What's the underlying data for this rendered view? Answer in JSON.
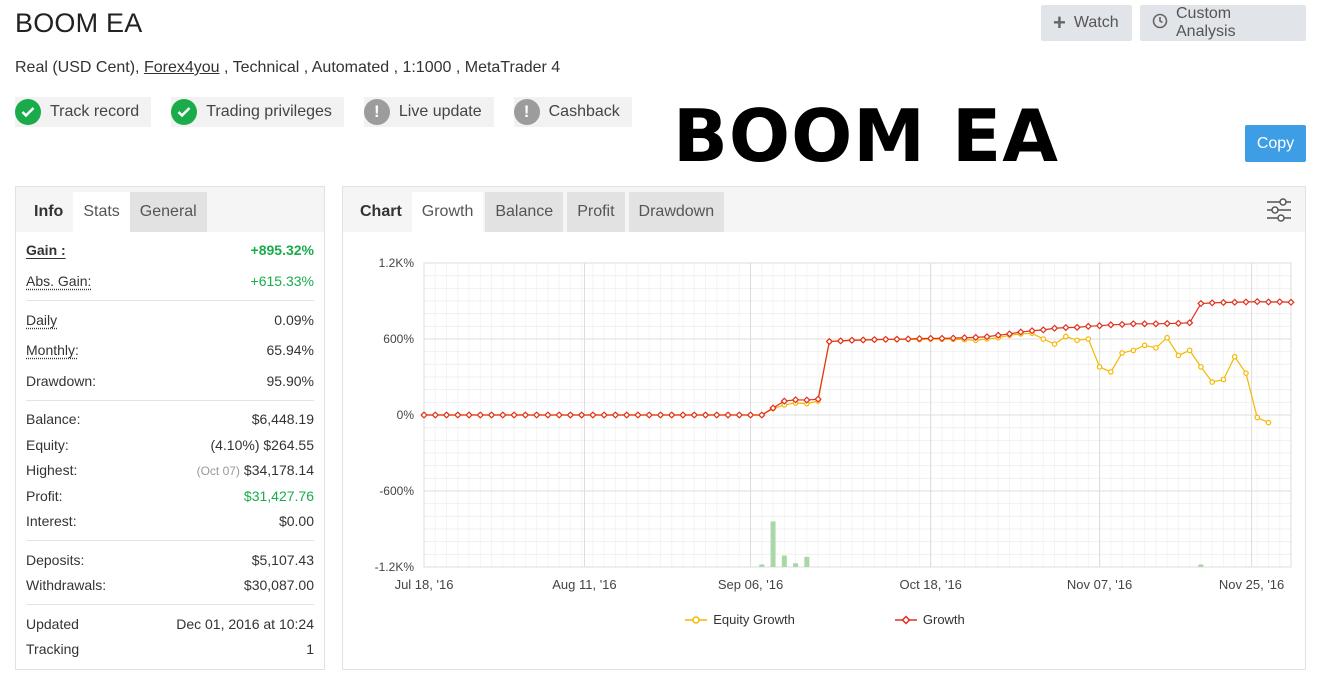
{
  "header": {
    "title": "BOOM EA",
    "subtitle_prefix": "Real (USD Cent),",
    "broker_link": "Forex4you",
    "subtitle_suffix": ", Technical , Automated , 1:1000 , MetaTrader 4",
    "watch_label": "Watch",
    "analysis_label": "Custom Analysis",
    "copy_label": "Copy",
    "overlay_text": "BOOM EA"
  },
  "badges": [
    {
      "label": "Track record",
      "status": "verified",
      "icon": "check-icon"
    },
    {
      "label": "Trading privileges",
      "status": "verified",
      "icon": "check-icon"
    },
    {
      "label": "Live update",
      "status": "unverified",
      "icon": "exclamation-icon"
    },
    {
      "label": "Cashback",
      "status": "unverified",
      "icon": "exclamation-icon"
    }
  ],
  "left_tabs": {
    "info": "Info",
    "stats": "Stats",
    "general": "General"
  },
  "stats": {
    "gain_label": "Gain :",
    "gain": "+895.32%",
    "abs_gain_label": "Abs. Gain:",
    "abs_gain": "+615.33%",
    "daily_label": "Daily",
    "daily": "0.09%",
    "monthly_label": "Monthly:",
    "monthly": "65.94%",
    "drawdown_label": "Drawdown:",
    "drawdown": "95.90%",
    "balance_label": "Balance:",
    "balance": "$6,448.19",
    "equity_label": "Equity:",
    "equity_pct": "(4.10%)",
    "equity": "$264.55",
    "highest_label": "Highest:",
    "highest_date": "(Oct 07)",
    "highest": "$34,178.14",
    "profit_label": "Profit:",
    "profit": "$31,427.76",
    "interest_label": "Interest:",
    "interest": "$0.00",
    "deposits_label": "Deposits:",
    "deposits": "$5,107.43",
    "withdrawals_label": "Withdrawals:",
    "withdrawals": "$30,087.00",
    "updated_label": "Updated",
    "updated": "Dec 01, 2016 at 10:24",
    "tracking_label": "Tracking",
    "tracking": "1"
  },
  "right_tabs": {
    "chart": "Chart",
    "growth": "Growth",
    "balance": "Balance",
    "profit": "Profit",
    "drawdown": "Drawdown"
  },
  "colors": {
    "green": "#1aab4b",
    "equity": "#f5b800",
    "growth": "#e0301e",
    "volume": "#a8d8a8",
    "copy": "#3d9ee6"
  },
  "chart_data": {
    "type": "line",
    "y_ticks": [
      "1.2K%",
      "600%",
      "0%",
      "-600%",
      "-1.2K%"
    ],
    "y_tick_values": [
      1200,
      600,
      0,
      -600,
      -1200
    ],
    "ylim": [
      -1200,
      1200
    ],
    "x_ticks": [
      "Jul 18, '16",
      "Aug 11, '16",
      "Sep 06, '16",
      "Oct 18, '16",
      "Nov 07, '16",
      "Nov 25, '16"
    ],
    "x_tick_index": [
      0,
      24,
      50,
      92,
      112,
      130
    ],
    "x_count": 135,
    "series": [
      {
        "name": "Growth",
        "points": [
          [
            0,
            0
          ],
          [
            2,
            0
          ],
          [
            4,
            0
          ],
          [
            6,
            0
          ],
          [
            8,
            0
          ],
          [
            10,
            0
          ],
          [
            12,
            0
          ],
          [
            14,
            0
          ],
          [
            16,
            0
          ],
          [
            18,
            0
          ],
          [
            20,
            0
          ],
          [
            22,
            0
          ],
          [
            24,
            0
          ],
          [
            26,
            0
          ],
          [
            28,
            0
          ],
          [
            30,
            0
          ],
          [
            32,
            0
          ],
          [
            34,
            0
          ],
          [
            36,
            0
          ],
          [
            38,
            0
          ],
          [
            40,
            0
          ],
          [
            42,
            0
          ],
          [
            44,
            0
          ],
          [
            46,
            0
          ],
          [
            48,
            0
          ],
          [
            50,
            0
          ],
          [
            52,
            0
          ],
          [
            54,
            0
          ],
          [
            56,
            0
          ],
          [
            58,
            0
          ],
          [
            60,
            0
          ],
          [
            62,
            55
          ],
          [
            64,
            110
          ],
          [
            66,
            120
          ],
          [
            68,
            118
          ],
          [
            70,
            125
          ],
          [
            72,
            580
          ],
          [
            74,
            585
          ],
          [
            76,
            590
          ],
          [
            78,
            592
          ],
          [
            80,
            595
          ],
          [
            82,
            597
          ],
          [
            84,
            598
          ],
          [
            86,
            600
          ],
          [
            88,
            603
          ],
          [
            90,
            605
          ],
          [
            92,
            605
          ],
          [
            94,
            607
          ],
          [
            96,
            610
          ],
          [
            98,
            613
          ],
          [
            100,
            618
          ],
          [
            102,
            630
          ],
          [
            104,
            640
          ],
          [
            106,
            655
          ],
          [
            108,
            665
          ],
          [
            110,
            672
          ],
          [
            112,
            685
          ],
          [
            114,
            690
          ],
          [
            116,
            692
          ],
          [
            118,
            700
          ],
          [
            120,
            705
          ],
          [
            122,
            712
          ],
          [
            124,
            715
          ],
          [
            126,
            720
          ],
          [
            128,
            720
          ],
          [
            130,
            720
          ],
          [
            132,
            722
          ],
          [
            134,
            724
          ],
          [
            136,
            728
          ],
          [
            138,
            880
          ],
          [
            140,
            885
          ],
          [
            142,
            888
          ],
          [
            144,
            890
          ],
          [
            146,
            892
          ],
          [
            148,
            895
          ],
          [
            150,
            892
          ],
          [
            152,
            893
          ],
          [
            154,
            890
          ]
        ]
      },
      {
        "name": "Equity Growth",
        "points": [
          [
            0,
            0
          ],
          [
            2,
            0
          ],
          [
            4,
            0
          ],
          [
            6,
            0
          ],
          [
            8,
            0
          ],
          [
            10,
            0
          ],
          [
            12,
            0
          ],
          [
            14,
            0
          ],
          [
            16,
            0
          ],
          [
            18,
            0
          ],
          [
            20,
            0
          ],
          [
            22,
            0
          ],
          [
            24,
            0
          ],
          [
            26,
            0
          ],
          [
            28,
            0
          ],
          [
            30,
            0
          ],
          [
            32,
            0
          ],
          [
            34,
            0
          ],
          [
            36,
            0
          ],
          [
            38,
            0
          ],
          [
            40,
            0
          ],
          [
            42,
            0
          ],
          [
            44,
            0
          ],
          [
            46,
            0
          ],
          [
            48,
            0
          ],
          [
            50,
            0
          ],
          [
            52,
            0
          ],
          [
            54,
            0
          ],
          [
            56,
            0
          ],
          [
            58,
            0
          ],
          [
            60,
            0
          ],
          [
            62,
            50
          ],
          [
            64,
            80
          ],
          [
            66,
            95
          ],
          [
            68,
            90
          ],
          [
            70,
            110
          ],
          [
            72,
            580
          ],
          [
            74,
            585
          ],
          [
            76,
            590
          ],
          [
            78,
            592
          ],
          [
            80,
            595
          ],
          [
            82,
            597
          ],
          [
            84,
            598
          ],
          [
            86,
            598
          ],
          [
            88,
            595
          ],
          [
            90,
            600
          ],
          [
            92,
            598
          ],
          [
            94,
            598
          ],
          [
            96,
            595
          ],
          [
            98,
            590
          ],
          [
            100,
            600
          ],
          [
            102,
            610
          ],
          [
            104,
            630
          ],
          [
            106,
            640
          ],
          [
            108,
            645
          ],
          [
            110,
            600
          ],
          [
            112,
            560
          ],
          [
            114,
            620
          ],
          [
            116,
            590
          ],
          [
            118,
            600
          ],
          [
            120,
            380
          ],
          [
            122,
            340
          ],
          [
            124,
            490
          ],
          [
            126,
            510
          ],
          [
            128,
            550
          ],
          [
            130,
            530
          ],
          [
            132,
            610
          ],
          [
            134,
            470
          ],
          [
            136,
            510
          ],
          [
            138,
            380
          ],
          [
            140,
            260
          ],
          [
            142,
            280
          ],
          [
            144,
            460
          ],
          [
            146,
            330
          ],
          [
            148,
            -20
          ],
          [
            150,
            -60
          ]
        ]
      },
      {
        "name": "Volume",
        "points": [
          [
            60,
            20
          ],
          [
            62,
            360
          ],
          [
            64,
            90
          ],
          [
            66,
            30
          ],
          [
            68,
            80
          ],
          [
            138,
            20
          ]
        ]
      }
    ],
    "legend": [
      "Equity Growth",
      "Growth"
    ],
    "legend_position": "bottom",
    "grid": true
  }
}
